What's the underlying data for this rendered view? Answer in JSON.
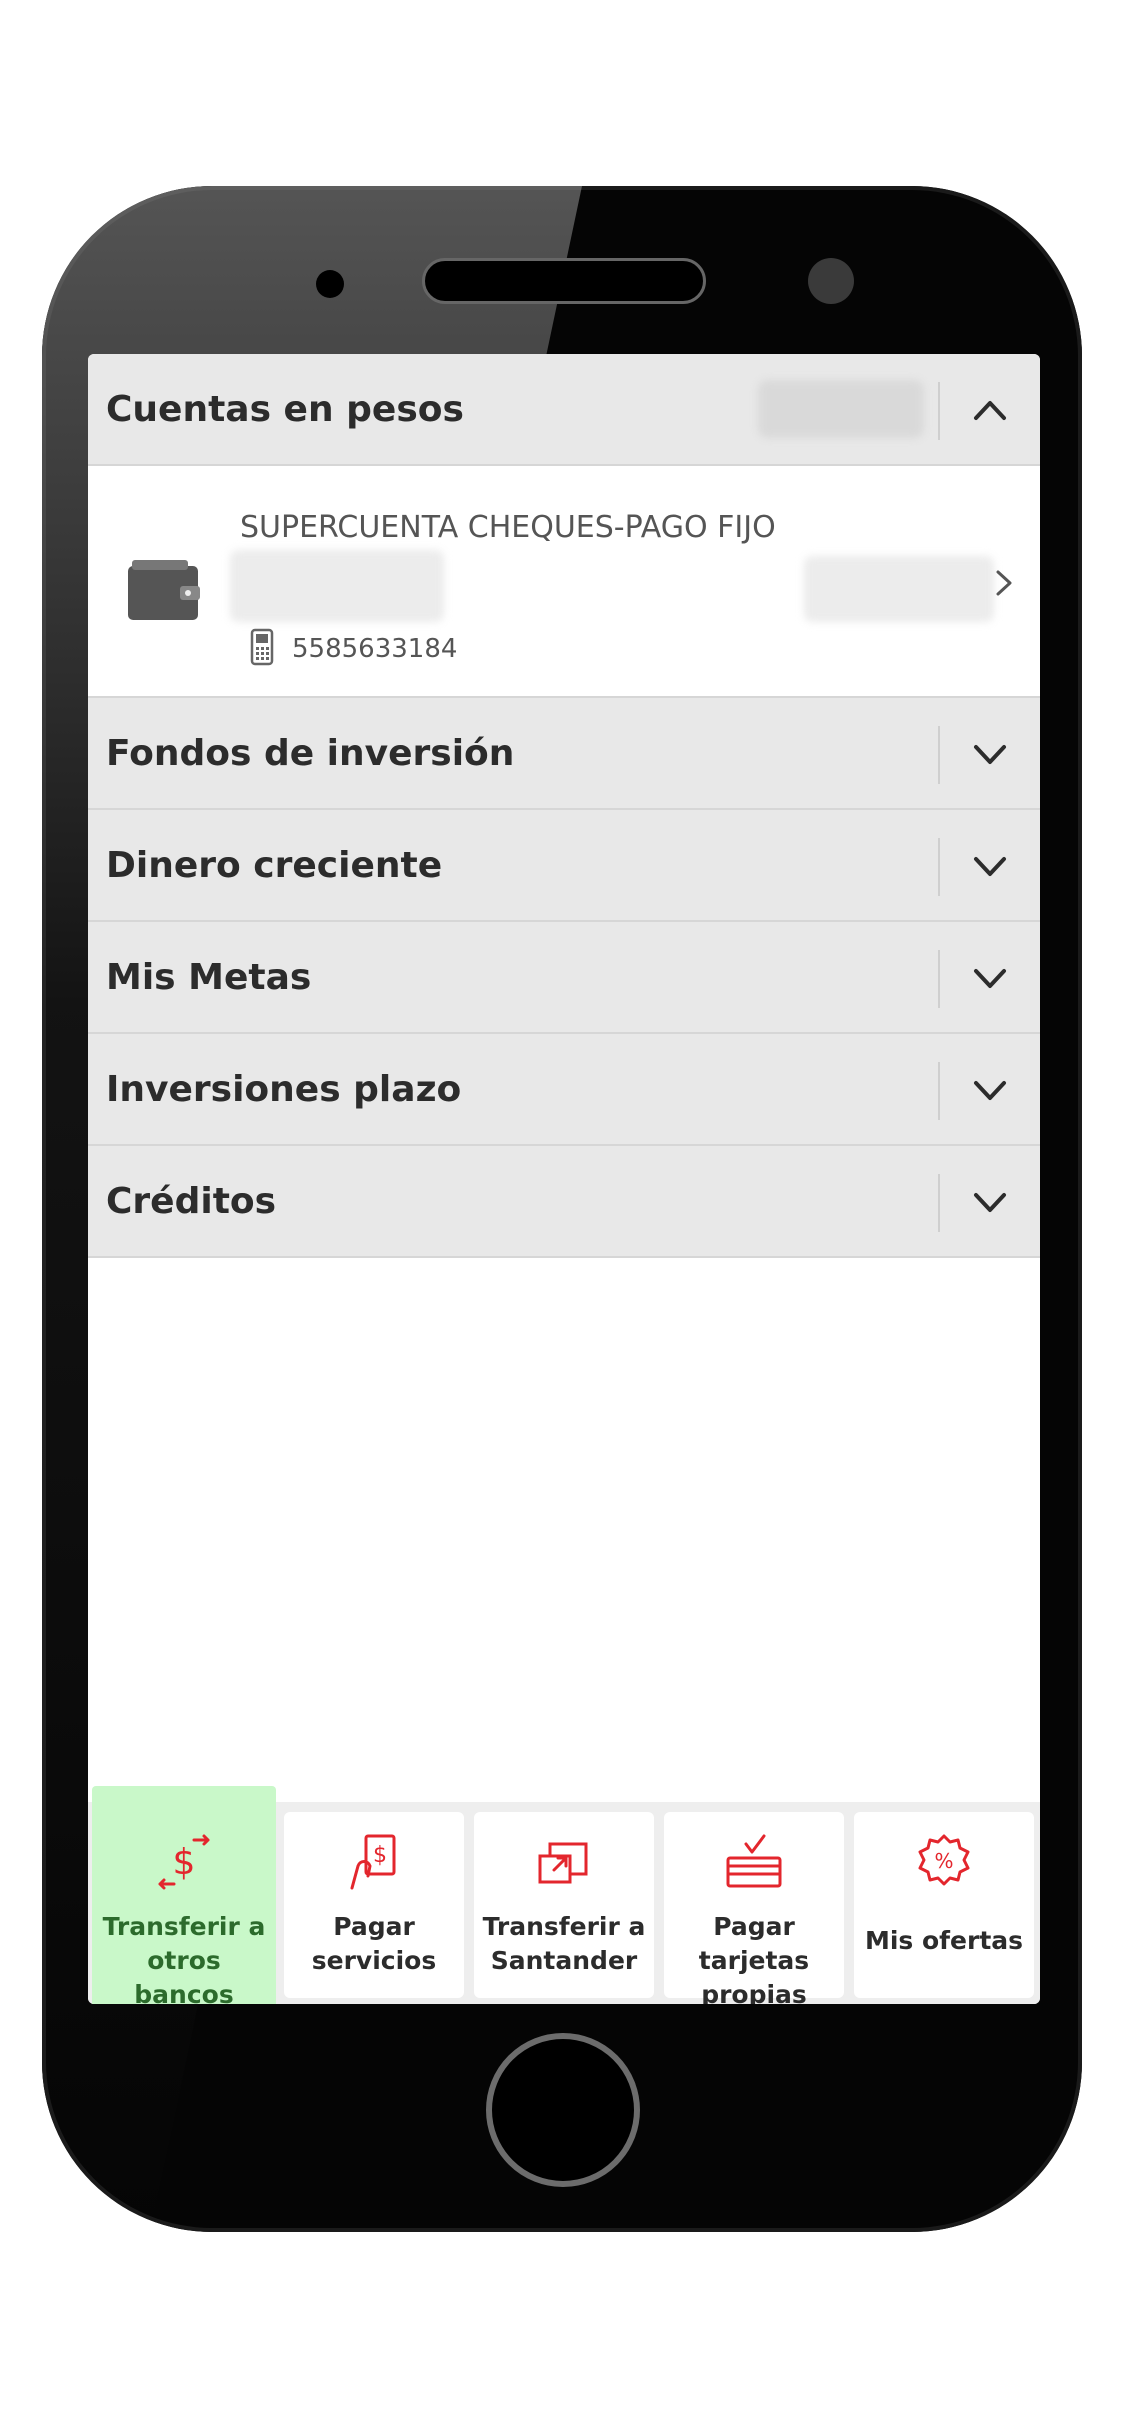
{
  "sections": [
    {
      "title": "Cuentas en pesos",
      "expanded": true,
      "icon": "chevron-up-icon"
    },
    {
      "title": "Fondos de inversión",
      "expanded": false,
      "icon": "chevron-down-icon"
    },
    {
      "title": "Dinero creciente",
      "expanded": false,
      "icon": "chevron-down-icon"
    },
    {
      "title": "Mis Metas",
      "expanded": false,
      "icon": "chevron-down-icon"
    },
    {
      "title": "Inversiones plazo",
      "expanded": false,
      "icon": "chevron-down-icon"
    },
    {
      "title": "Créditos",
      "expanded": false,
      "icon": "chevron-down-icon"
    }
  ],
  "account": {
    "name": "SUPERCUENTA CHEQUES-PAGO FIJO",
    "phone": "5585633184",
    "icon": "wallet-icon"
  },
  "actions": [
    {
      "label1": "Transferir a",
      "label2": "otros bancos",
      "icon": "transfer-money-icon",
      "highlighted": true
    },
    {
      "label1": "Pagar",
      "label2": "servicios",
      "icon": "pay-bill-icon",
      "highlighted": false
    },
    {
      "label1": "Transferir a",
      "label2": "Santander",
      "icon": "transfer-icon",
      "highlighted": false
    },
    {
      "label1": "Pagar tarjetas",
      "label2": "propias",
      "icon": "card-pay-icon",
      "highlighted": false
    },
    {
      "label1": "Mis ofertas",
      "label2": "",
      "icon": "percent-badge-icon",
      "highlighted": false
    }
  ],
  "colors": {
    "accent_red": "#e3262d",
    "highlight_green": "#c9f8c9",
    "section_bg": "#e8e8e8"
  }
}
